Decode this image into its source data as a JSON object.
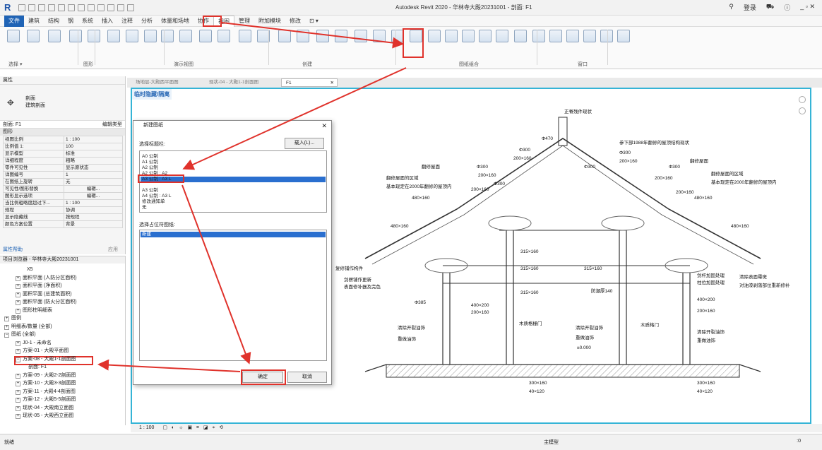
{
  "app": {
    "logo": "R",
    "title": "Autodesk Revit 2020 - 华林寺大殿20231001 - 剖面: F1",
    "search_icon": "binoculars-icon",
    "login": "登录",
    "cart": "cart-icon",
    "help": "help-icon",
    "window_controls": "_ ▫ ✕"
  },
  "menu": [
    "文件",
    "建筑",
    "结构",
    "钢",
    "系统",
    "插入",
    "注释",
    "分析",
    "体量和场地",
    "协作",
    "视图",
    "管理",
    "附加模块",
    "修改",
    "⊡ ▾"
  ],
  "menu_active_index": 10,
  "ribbon": {
    "left_dropdown": "选择 ▾",
    "groups": [
      "图形",
      "演示视图",
      "创建",
      "图纸组合",
      "窗口"
    ]
  },
  "properties": {
    "title": "属性",
    "type_name_1": "剖面",
    "type_name_2": "建筑剖面",
    "selector": "剖面: F1",
    "edit_type": "编辑类型",
    "section": "图形",
    "rows": [
      [
        "视图比例",
        "1 : 100"
      ],
      [
        "比例值 1:",
        "100"
      ],
      [
        "显示模型",
        "标准"
      ],
      [
        "详细程度",
        "粗略"
      ],
      [
        "零件可见性",
        "显示原状态"
      ],
      [
        "详图编号",
        "1"
      ],
      [
        "在图纸上旋转",
        "无"
      ],
      [
        "可见性/图形替换",
        "编辑..."
      ],
      [
        "图形显示选项",
        "编辑..."
      ],
      [
        "当比例粗略度超过下...",
        "1 : 100"
      ],
      [
        "规程",
        "协调"
      ],
      [
        "显示隐藏线",
        "按规程"
      ],
      [
        "颜色方案位置",
        "背景"
      ]
    ],
    "help": "属性帮助",
    "apply": "应用"
  },
  "browser": {
    "title": "项目浏览器 - 华林寺大殿20231001",
    "nodes": [
      "X5",
      "面积平面 (人防分区面积)",
      "面积平面 (净面积)",
      "面积平面 (总建筑面积)",
      "面积平面 (防火分区面积)",
      "图形柱明细表",
      "图例",
      "明细表/数量 (全部)",
      "图纸 (全部)",
      "J0-1 - 未命名",
      "方案-01 - 大殿平面图",
      "方案-08 - 大殿1-1剖面图",
      "剖面: F1",
      "方案-09 - 大殿2-2剖面图",
      "方案-10 - 大殿3-3剖面图",
      "方案-11 - 大殿4-4剖面图",
      "方案-12 - 大殿5-5剖面图",
      "现状-04 - 大殿南立面图",
      "现状-05 - 大殿西立面图"
    ]
  },
  "view_tabs": [
    "场地层-大殿西平面图",
    "现状-04 - 大殿1-1剖面图",
    "F1"
  ],
  "canvas": {
    "temp_label": "临时隐藏/隔离",
    "annotations": [
      "正脊残件现状",
      "Φ470",
      "参下部1988年翻修的屋顶结构现状",
      "Φ300",
      "Φ300",
      "Φ300",
      "Φ300",
      "Φ300",
      "Φ300",
      "200×160",
      "200×160",
      "200×160",
      "200×160",
      "200×160",
      "200×160",
      "翻修屋面",
      "翻修屋面",
      "翻修屋面的区域",
      "翻修屋面的区域",
      "基本现定在2000年翻修的屋顶内",
      "基本现定在2000年翻修的屋顶内",
      "480×160",
      "480×160",
      "480×160",
      "480×160",
      "315×160",
      "315×160",
      "315×160",
      "315×160",
      "Φ385",
      "400×200",
      "200×160",
      "400×200",
      "200×160",
      "复修铺作构件",
      "剑楞铺作更新",
      "表面修补器及完色",
      "剑杆加固处理",
      "柱位加固处理",
      "清除表面霉斑",
      "对油漆剥落部位重新修补",
      "防潮厚140",
      "木质格栅门",
      "木质格门",
      "清除开裂油饰",
      "重做油饰",
      "清除开裂油饰",
      "重做油饰",
      "清除开裂油饰",
      "重做油饰",
      "±0.000",
      "300×160",
      "40×120",
      "300×160",
      "40×120"
    ]
  },
  "dialog": {
    "title": "新建图纸",
    "select_title_label": "选择标题栏:",
    "load_button": "载入(L)...",
    "titleblocks": [
      "A0 公制",
      "A1 公制",
      "A2 公制",
      "A2 公制 : A2",
      "A3 公制 : A3 L",
      "A3 公制",
      "A3 公制",
      "A4 公制 : A3 L",
      "修改通知单",
      "无"
    ],
    "selected_index": 5,
    "placeholder_label": "选择占位符图纸:",
    "placeholder_items": [
      "新建"
    ],
    "ok": "确定",
    "cancel": "取消"
  },
  "view_control": "1 : 100",
  "status": {
    "left": "就绪",
    "model": "主模型",
    "right": ":0"
  },
  "colors": {
    "accent": "#1f63b5",
    "highlight": "#e0322b",
    "canvas_border": "#35b4d6"
  }
}
